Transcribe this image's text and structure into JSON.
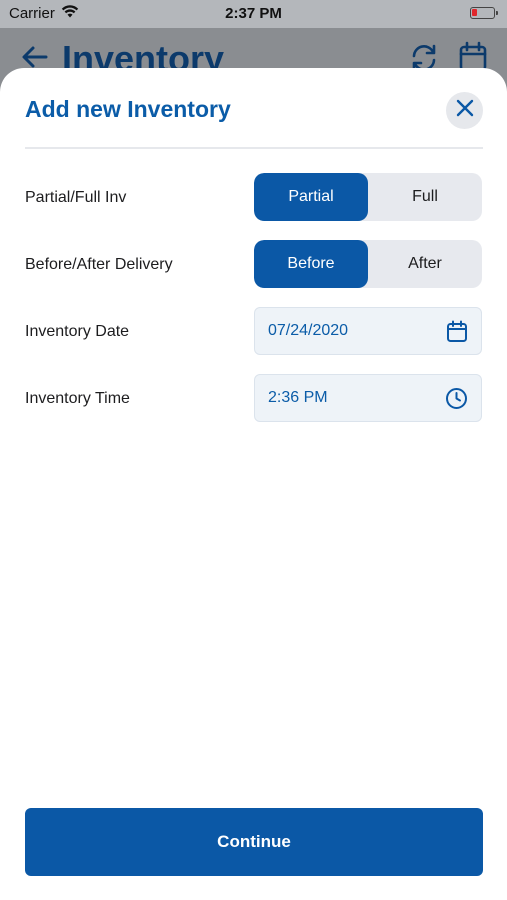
{
  "status_bar": {
    "carrier": "Carrier",
    "time": "2:37 PM"
  },
  "background_header": {
    "title": "Inventory"
  },
  "sheet": {
    "title": "Add new Inventory",
    "rows": [
      {
        "label": "Partial/Full Inv",
        "options": [
          "Partial",
          "Full"
        ],
        "selected": "Partial"
      },
      {
        "label": "Before/After Delivery",
        "options": [
          "Before",
          "After"
        ],
        "selected": "Before"
      }
    ],
    "date": {
      "label": "Inventory Date",
      "value": "07/24/2020"
    },
    "time": {
      "label": "Inventory Time",
      "value": "2:36 PM"
    },
    "continue_label": "Continue"
  },
  "colors": {
    "accent": "#0b58a6",
    "title": "#0b5ca8",
    "segment_bg": "#e7e9ee",
    "field_bg": "#eef3f8"
  },
  "icons": {
    "back": "arrow-left-icon",
    "refresh": "refresh-icon",
    "calendar": "calendar-icon",
    "close": "close-icon",
    "clock": "clock-icon",
    "wifi": "wifi-icon",
    "battery": "battery-icon"
  }
}
